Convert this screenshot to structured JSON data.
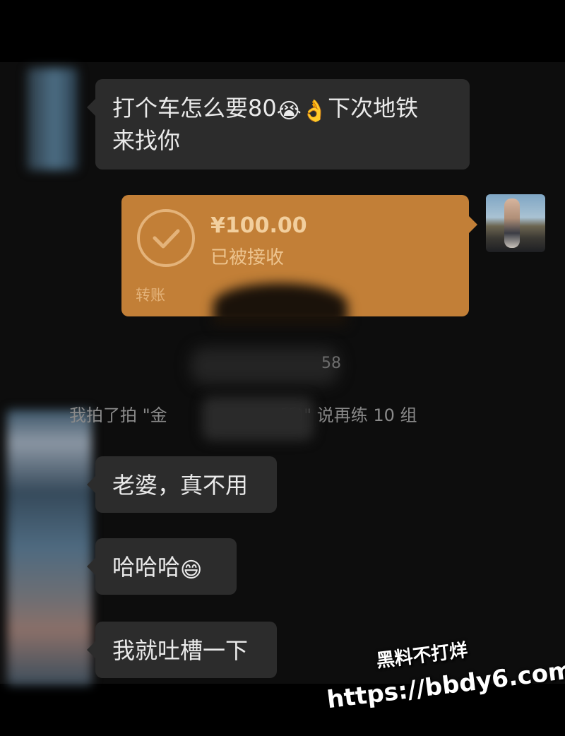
{
  "messages": {
    "m1": {
      "text_a": "打个车怎么要80",
      "emoji_a": "😭",
      "emoji_b": "👌",
      "text_b": "下次地铁",
      "text_c": "来找你"
    },
    "transfer": {
      "amount": "¥100.00",
      "status": "已被接收",
      "label": "转账",
      "accent": "#c27f37"
    },
    "timestamp_fragment": "58",
    "pat_notice": {
      "before": "我拍了拍 \"金",
      "after": "所)\" 说再练 10 组"
    },
    "m2": {
      "text": "老婆，真不用"
    },
    "m3": {
      "text": "哈哈哈",
      "emoji": "😄"
    },
    "m4": {
      "text": "我就吐槽一下"
    }
  },
  "watermark": {
    "line1": "黑料不打烊",
    "line2": "https://bbdy6.com"
  },
  "colors": {
    "background": "#0d0d0d",
    "bubble": "#2c2c2c",
    "text": "#eaeaea"
  }
}
